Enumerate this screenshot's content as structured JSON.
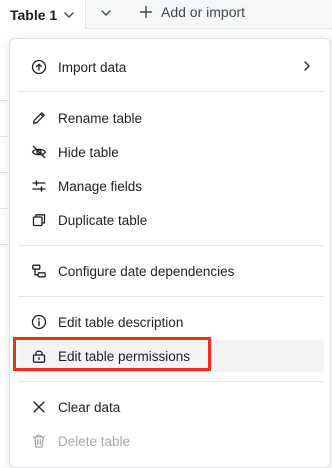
{
  "topbar": {
    "active_tab": "Table 1",
    "add_label": "Add or import"
  },
  "menu": {
    "import_data": "Import data",
    "rename_table": "Rename table",
    "hide_table": "Hide table",
    "manage_fields": "Manage fields",
    "duplicate_table": "Duplicate table",
    "configure_date_dependencies": "Configure date dependencies",
    "edit_table_description": "Edit table description",
    "edit_table_permissions": "Edit table permissions",
    "clear_data": "Clear data",
    "delete_table": "Delete table"
  },
  "colors": {
    "highlight": "#e8321b",
    "hover_bg": "#f2f3f5",
    "disabled_text": "#a4a7ad"
  }
}
